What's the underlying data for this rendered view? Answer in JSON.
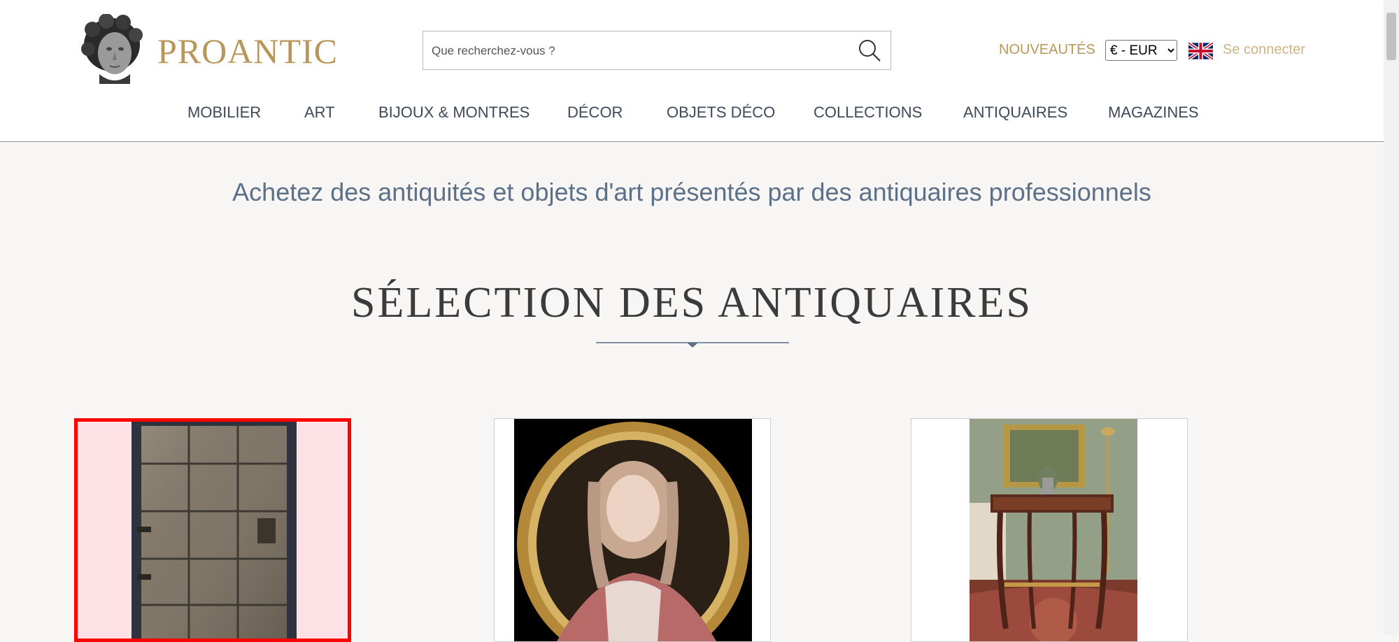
{
  "header": {
    "logo": {
      "text": "PROANTIC",
      "icon": "sculpted-head-icon"
    },
    "search": {
      "placeholder": "Que recherchez-vous ?",
      "value": "",
      "icon": "search-icon"
    },
    "nouveautes_label": "NOUVEAUTÉS",
    "currency": {
      "selected": "€ - EUR",
      "options": [
        "€ - EUR"
      ]
    },
    "language_icon": "uk-flag-icon",
    "login_label": "Se connecter"
  },
  "nav": {
    "items": [
      {
        "label": "MOBILIER"
      },
      {
        "label": "ART"
      },
      {
        "label": "BIJOUX & MONTRES"
      },
      {
        "label": "DÉCOR"
      },
      {
        "label": "OBJETS DÉCO"
      },
      {
        "label": "COLLECTIONS"
      },
      {
        "label": "ANTIQUAIRES"
      },
      {
        "label": "MAGAZINES"
      }
    ]
  },
  "main": {
    "tagline": "Achetez des antiquités et objets d'art présentés par des antiquaires professionnels",
    "section_title": "SÉLECTION DES ANTIQUAIRES",
    "cards": [
      {
        "image": "iron-door-image",
        "selected": true
      },
      {
        "image": "oval-portrait-image",
        "selected": false
      },
      {
        "image": "side-table-image",
        "selected": false
      }
    ]
  },
  "colors": {
    "gold": "#b8975a",
    "nav_text": "#3e4a59",
    "tagline": "#5c7088",
    "selection_border": "#ff0000"
  }
}
